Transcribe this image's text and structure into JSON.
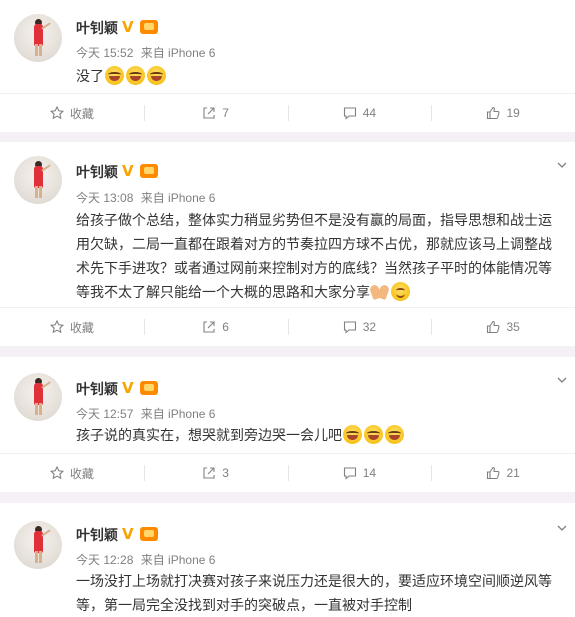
{
  "posts": [
    {
      "name": "叶钊颖",
      "time": "今天 15:52",
      "source": "来自 iPhone 6",
      "text": "没了",
      "emojis": [
        "laugh",
        "laugh",
        "laugh"
      ],
      "actions": {
        "favorite": "收藏",
        "share": "7",
        "comment": "44",
        "like": "19"
      }
    },
    {
      "name": "叶钊颖",
      "time": "今天 13:08",
      "source": "来自 iPhone 6",
      "text": "给孩子做个总结，整体实力稍显劣势但不是没有赢的局面，指导思想和战士运用欠缺，二局一直都在跟着对方的节奏拉四方球不占优，那就应该马上调整战术先下手进攻？或者通过网前来控制对方的底线？当然孩子平时的体能情况等等我不太了解只能给一个大概的思路和大家分享",
      "emojis": [
        "pray",
        "smile"
      ],
      "actions": {
        "favorite": "收藏",
        "share": "6",
        "comment": "32",
        "like": "35"
      }
    },
    {
      "name": "叶钊颖",
      "time": "今天 12:57",
      "source": "来自 iPhone 6",
      "text": "孩子说的真实在，想哭就到旁边哭一会儿吧",
      "emojis": [
        "laugh",
        "laugh",
        "laugh"
      ],
      "actions": {
        "favorite": "收藏",
        "share": "3",
        "comment": "14",
        "like": "21"
      }
    },
    {
      "name": "叶钊颖",
      "time": "今天 12:28",
      "source": "来自 iPhone 6",
      "text": "一场没打上场就打决赛对孩子来说压力还是很大的，要适应环境空间顺逆风等等，第一局完全没找到对手的突破点，一直被对手控制",
      "emojis": []
    }
  ]
}
